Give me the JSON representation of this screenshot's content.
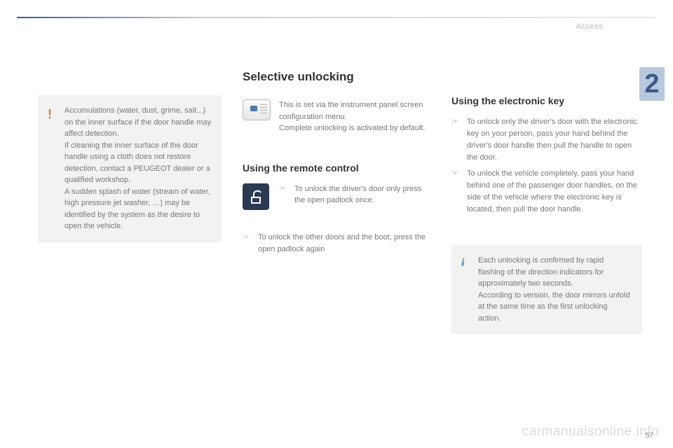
{
  "header": {
    "section": "Access",
    "chapter": "2"
  },
  "left": {
    "warning": "Accumulations (water, dust, grime, salt...) on the inner surface if the door handle may affect detection.\nIf cleaning the inner surface of the door handle using a cloth does not restore detection, contact a PEUGEOT dealer or a qualified workshop.\nA sudden splash of water (stream of water, high pressure jet washer, …) may be identified by the system as the desire to open the vehicle."
  },
  "mid": {
    "title": "Selective unlocking",
    "panel_text": "This is set via the instrument panel screen configuration menu.\nComplete unlocking is activated by default.",
    "remote_title": "Using the remote control",
    "remote_bullet": "To unlock the driver's door only press the open padlock once.",
    "remote_bullet2": "To unlock the other doors and the boot, press the open padlock again"
  },
  "right": {
    "title": "Using the electronic key",
    "bullets": [
      "To unlock only the driver's door with the electronic key on your person, pass your hand behind the driver's door handle then pull the handle to open the door.",
      "To unlock the vehicle completely, pass your hand behind one of the passenger door handles, on the side of the vehicle where the electronic key is located, then pull the door handle."
    ],
    "info": "Each unlocking is confirmed by rapid flashing of the direction indicators for approximately two seconds.\nAccording to version, the door mirrors unfold at the same time as the first unlocking action."
  },
  "footer": {
    "watermark": "carmanualsonline.info",
    "page": "57"
  },
  "bullet_mark": "☞"
}
